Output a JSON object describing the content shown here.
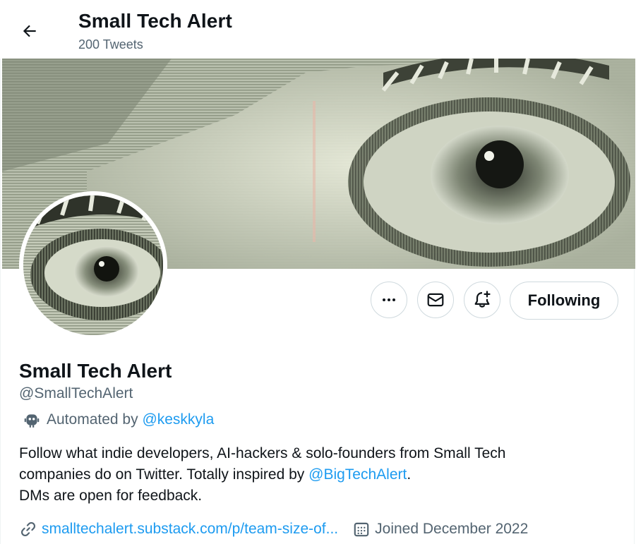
{
  "header": {
    "title": "Small Tech Alert",
    "tweet_count": "200 Tweets",
    "back_icon": "arrow-left-icon"
  },
  "profile": {
    "name": "Small Tech Alert",
    "handle": "@SmallTechAlert",
    "automated_prefix": "Automated by",
    "automated_by": "@keskkyla",
    "bio_line1": "Follow what indie developers, AI-hackers & solo-founders from Small Tech",
    "bio_line2_prefix": "companies do on Twitter. Totally inspired by",
    "bio_mention": "@BigTechAlert",
    "bio_line2_suffix": ".",
    "bio_line3": "DMs are open for feedback.",
    "website": "smalltechalert.substack.com/p/team-size-of...",
    "joined": "Joined December 2022"
  },
  "actions": {
    "more_icon": "more-icon",
    "message_icon": "envelope-icon",
    "notify_icon": "bell-plus-icon",
    "following_label": "Following"
  },
  "colors": {
    "accent": "#1d9bf0",
    "text": "#0f1419",
    "muted": "#536471",
    "border": "#cfd9de"
  }
}
